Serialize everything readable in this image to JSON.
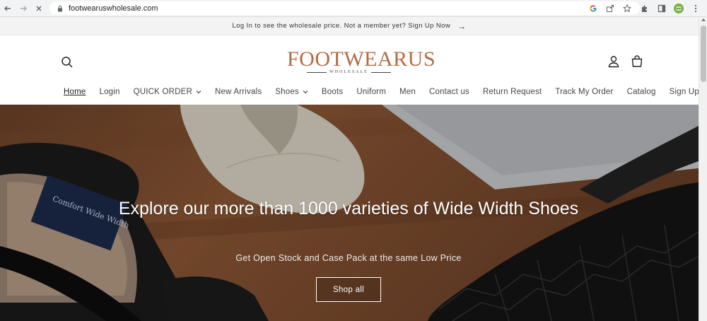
{
  "browser": {
    "url": "footwearuswholesale.com",
    "icons": [
      "back-icon",
      "forward-icon",
      "stop-icon",
      "lock-icon",
      "google-icon",
      "share-icon",
      "star-icon",
      "extensions-icon",
      "sidepanel-icon",
      "profile-icon",
      "menu-icon"
    ]
  },
  "announcement": {
    "text": "Log In to see the wholesale price. Not a member yet? Sign Up Now",
    "arrow": "→"
  },
  "header": {
    "logo_main": "FOOTWEARUS",
    "logo_sub": "WHOLESALE",
    "brand_color": "#b46a42"
  },
  "menu": {
    "items": [
      {
        "label": "Home",
        "active": true
      },
      {
        "label": "Login"
      },
      {
        "label": "QUICK ORDER",
        "dropdown": true
      },
      {
        "label": "New Arrivals"
      },
      {
        "label": "Shoes",
        "dropdown": true
      },
      {
        "label": "Boots"
      },
      {
        "label": "Uniform"
      },
      {
        "label": "Men"
      },
      {
        "label": "Contact us"
      },
      {
        "label": "Return Request"
      },
      {
        "label": "Track My Order"
      },
      {
        "label": "Catalog"
      },
      {
        "label": "Sign Up"
      }
    ]
  },
  "hero": {
    "title": "Explore our more than 1000 varieties of Wide Width Shoes",
    "subtitle": "Get Open Stock and Case Pack at the same Low Price",
    "button": "Shop all",
    "insole_text": "Comfort Wide Width"
  }
}
